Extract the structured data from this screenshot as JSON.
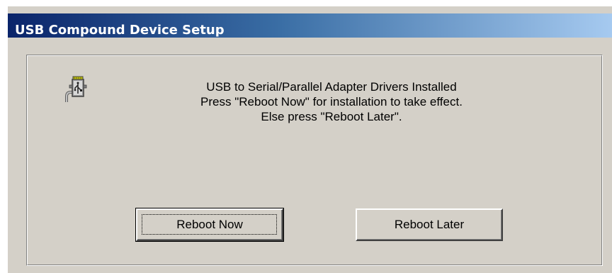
{
  "window": {
    "title": "USB Compound Device Setup"
  },
  "dialog": {
    "icon": "usb-adapter-icon",
    "message_lines": [
      "USB to Serial/Parallel Adapter Drivers Installed",
      "Press \"Reboot Now\" for installation to take effect.",
      "Else press \"Reboot Later\"."
    ]
  },
  "buttons": {
    "reboot_now_label": "Reboot Now",
    "reboot_later_label": "Reboot Later"
  },
  "colors": {
    "window_bg": "#d4d0c8",
    "title_gradient_start": "#0a246a",
    "title_gradient_end": "#a6caf0",
    "title_text": "#ffffff"
  }
}
